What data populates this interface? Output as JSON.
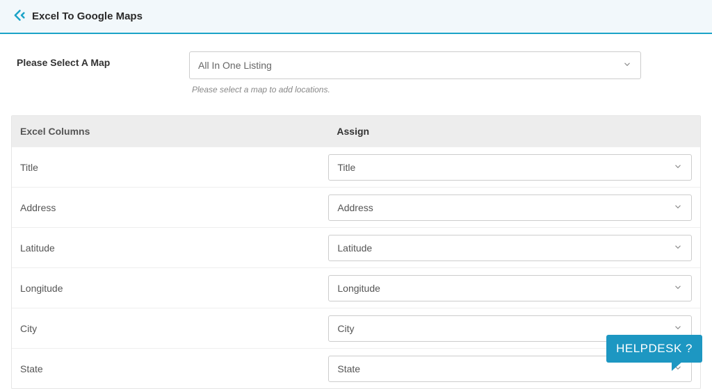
{
  "header": {
    "title": "Excel To Google Maps"
  },
  "map_select": {
    "label": "Please Select A Map",
    "value": "All In One Listing",
    "helper": "Please select a map to add locations."
  },
  "table": {
    "header_left": "Excel Columns",
    "header_right": "Assign",
    "rows": [
      {
        "column": "Title",
        "assign": "Title"
      },
      {
        "column": "Address",
        "assign": "Address"
      },
      {
        "column": "Latitude",
        "assign": "Latitude"
      },
      {
        "column": "Longitude",
        "assign": "Longitude"
      },
      {
        "column": "City",
        "assign": "City"
      },
      {
        "column": "State",
        "assign": "State"
      }
    ]
  },
  "helpdesk": {
    "label": "HELPDESK ?"
  }
}
